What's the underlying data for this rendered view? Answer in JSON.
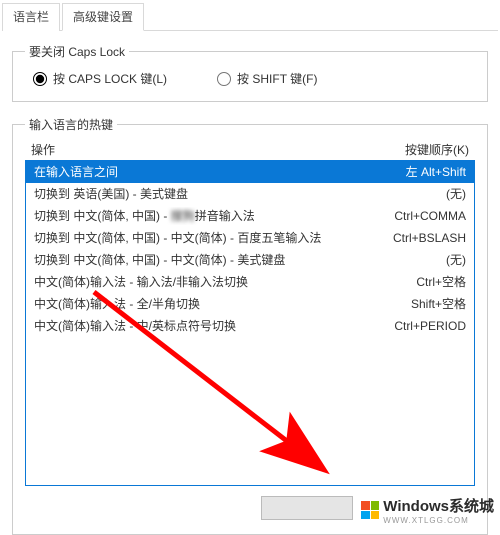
{
  "tabs": {
    "lang_bar": "语言栏",
    "advanced": "高级键设置"
  },
  "capslock_group": {
    "legend": "要关闭 Caps Lock",
    "opt_capslock": "按 CAPS LOCK 键(L)",
    "opt_shift": "按 SHIFT 键(F)"
  },
  "hotkeys_group": {
    "legend": "输入语言的热键",
    "header_action": "操作",
    "header_keys": "按键顺序(K)",
    "rows": [
      {
        "action": "在输入语言之间",
        "keys": "左 Alt+Shift",
        "selected": true
      },
      {
        "action": "切换到 英语(美国) - 美式键盘",
        "keys": "(无)",
        "selected": false
      },
      {
        "action_pre": "切换到 中文(简体, 中国) - ",
        "action_blur": "搜狗",
        "action_post": "拼音输入法",
        "keys": "Ctrl+COMMA",
        "selected": false
      },
      {
        "action": "切换到 中文(简体, 中国) - 中文(简体) - 百度五笔输入法",
        "keys": "Ctrl+BSLASH",
        "selected": false
      },
      {
        "action": "切换到 中文(简体, 中国) - 中文(简体) - 美式键盘",
        "keys": "(无)",
        "selected": false
      },
      {
        "action": "中文(简体)输入法 - 输入法/非输入法切换",
        "keys": "Ctrl+空格",
        "selected": false
      },
      {
        "action": "中文(简体)输入法 - 全/半角切换",
        "keys": "Shift+空格",
        "selected": false
      },
      {
        "action": "中文(简体)输入法 - 中/英标点符号切换",
        "keys": "Ctrl+PERIOD",
        "selected": false
      }
    ]
  },
  "watermark": {
    "brand": "Windows系统城",
    "sub": "WWW.XTLGG.COM"
  },
  "colors": {
    "selection": "#0a78d6",
    "arrow": "#ff0000"
  }
}
